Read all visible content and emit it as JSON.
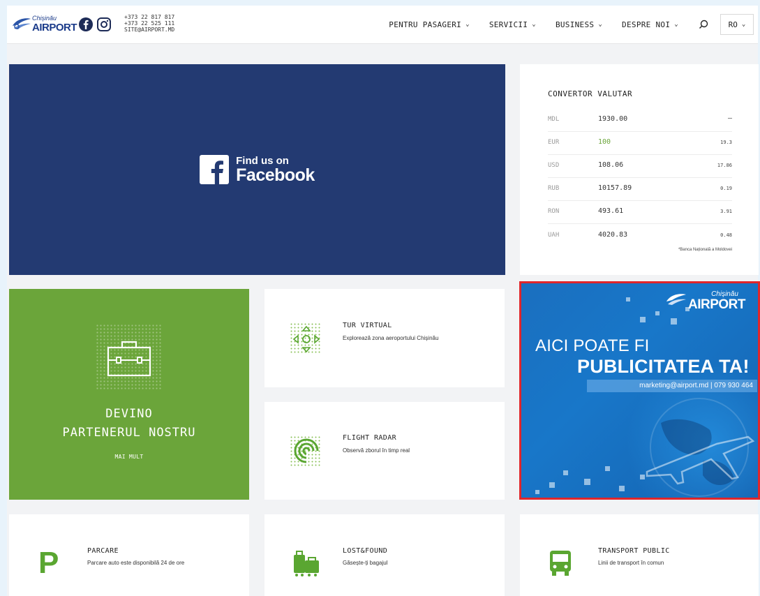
{
  "header": {
    "logo_city": "Chișinău",
    "logo_name": "AIRPORT",
    "phone1": "+373 22 817 817",
    "phone2": "+373 22 525 111",
    "email": "SITE@AIRPORT.MD",
    "nav": [
      {
        "label": "PENTRU PASAGERI"
      },
      {
        "label": "SERVICII"
      },
      {
        "label": "BUSINESS"
      },
      {
        "label": "DESPRE NOI"
      }
    ],
    "language": "RO"
  },
  "facebook_banner": {
    "line1": "Find us on",
    "line2": "Facebook",
    "bg_color": "#233a72"
  },
  "converter": {
    "title": "CONVERTOR VALUTAR",
    "rows": [
      {
        "code": "MDL",
        "amount": "1930.00",
        "rate": "—"
      },
      {
        "code": "EUR",
        "amount": "100",
        "rate": "19.3"
      },
      {
        "code": "USD",
        "amount": "108.06",
        "rate": "17.86"
      },
      {
        "code": "RUB",
        "amount": "10157.89",
        "rate": "0.19"
      },
      {
        "code": "RON",
        "amount": "493.61",
        "rate": "3.91"
      },
      {
        "code": "UAH",
        "amount": "4020.83",
        "rate": "0.48"
      }
    ],
    "note": "*Banca Națională a Moldovei",
    "highlight_color": "#6ba53a"
  },
  "partner": {
    "title_line1": "DEVINO",
    "title_line2": "PARTENERUL NOSTRU",
    "more": "MAI MULT",
    "bg_color": "#6ba53a"
  },
  "services": {
    "virtual_tour": {
      "title": "TUR VIRTUAL",
      "desc": "Explorează zona aeroportului Chișinău"
    },
    "flight_radar": {
      "title": "FLIGHT RADAR",
      "desc": "Observă zborul în timp real"
    },
    "parking": {
      "title": "PARCARE",
      "desc": "Parcare auto este disponibilă 24 de ore"
    },
    "lost_found": {
      "title": "LOST&FOUND",
      "desc": "Găsește-ți bagajul"
    },
    "transport": {
      "title": "TRANSPORT PUBLIC",
      "desc": "Linii de transport în comun"
    },
    "icon_color": "#5aa631"
  },
  "ad": {
    "logo_city": "Chișinău",
    "logo_name": "AIRPORT",
    "line1": "AICI POATE FI",
    "line2": "PUBLICITATEA TA!",
    "contact": "marketing@airport.md   |   079 930 464",
    "border_color": "#e0262b"
  }
}
